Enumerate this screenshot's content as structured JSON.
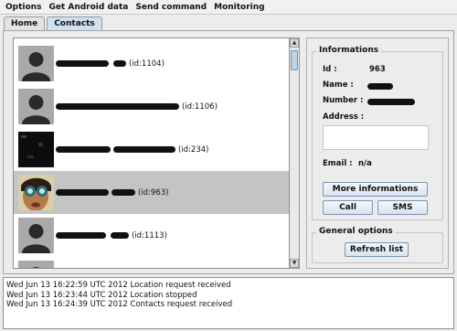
{
  "menu": [
    {
      "label": "Options"
    },
    {
      "label": "Get Android data"
    },
    {
      "label": "Send command"
    },
    {
      "label": "Monitoring"
    }
  ],
  "tabs": [
    {
      "label": "Home",
      "active": false
    },
    {
      "label": "Contacts",
      "active": true
    }
  ],
  "contacts": [
    {
      "id_text": "(id:1104)",
      "avatar": "silhouette",
      "selected": false
    },
    {
      "id_text": "(id:1106)",
      "avatar": "silhouette",
      "selected": false
    },
    {
      "id_text": "(id:234)",
      "avatar": "redacted-photo",
      "selected": false
    },
    {
      "id_text": "(id:963)",
      "avatar": "photo-goggles",
      "selected": true
    },
    {
      "id_text": "(id:1113)",
      "avatar": "silhouette",
      "selected": false
    },
    {
      "id_text": "",
      "avatar": "silhouette",
      "selected": false
    }
  ],
  "info": {
    "title": "Informations",
    "id_label": "Id :",
    "id_value": "963",
    "name_label": "Name :",
    "number_label": "Number :",
    "address_label": "Address :",
    "email_label": "Email :",
    "email_value": "n/a",
    "more_button": "More informations",
    "call_button": "Call",
    "sms_button": "SMS"
  },
  "general": {
    "title": "General options",
    "refresh_button": "Refresh list"
  },
  "log": [
    "Wed Jun 13 16:22:59 UTC 2012 Location request received",
    "Wed Jun 13 16:23:44 UTC 2012 Location stopped",
    "Wed Jun 13 16:24:39 UTC 2012 Contacts request received"
  ]
}
